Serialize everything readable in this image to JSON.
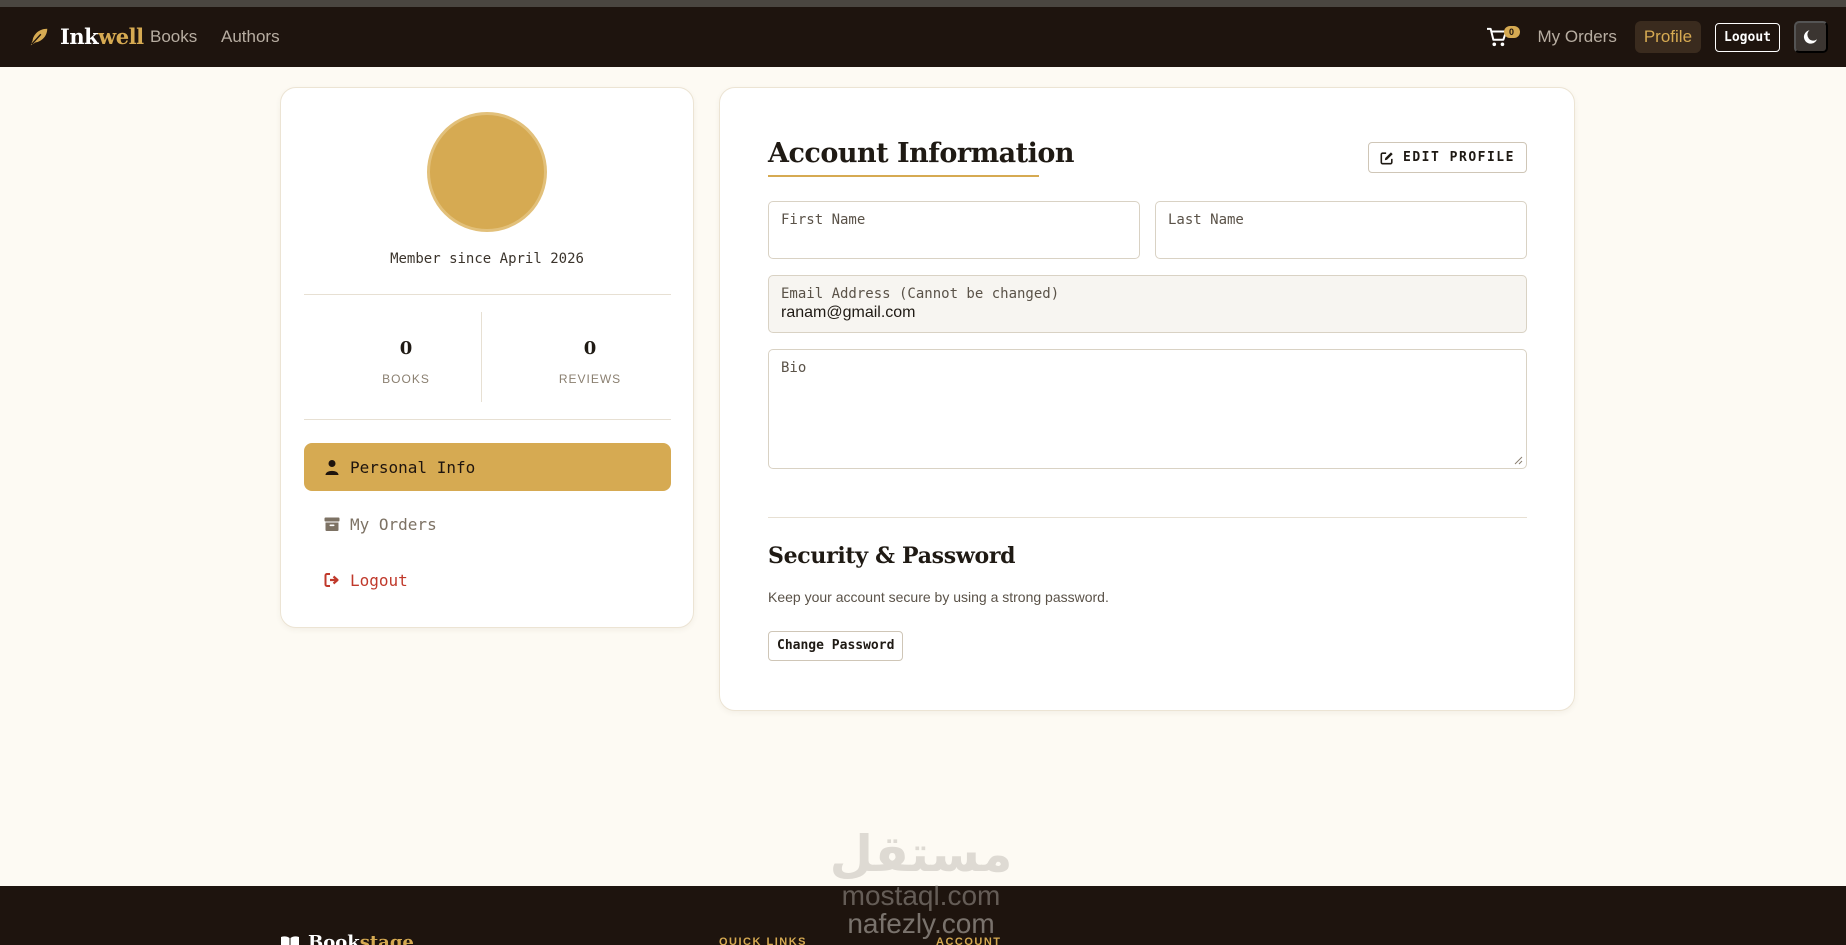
{
  "nav": {
    "brand_prefix": "Ink",
    "brand_accent": "well",
    "links": [
      "Books",
      "Authors"
    ],
    "cart_count": "0",
    "my_orders": "My Orders",
    "profile": "Profile",
    "logout": "Logout"
  },
  "sidebar": {
    "member_since": "Member since April 2026",
    "stats": [
      {
        "value": "0",
        "label": "BOOKS"
      },
      {
        "value": "0",
        "label": "REVIEWS"
      }
    ],
    "menu": [
      {
        "label": "Personal Info",
        "icon": "user-icon",
        "active": true
      },
      {
        "label": "My Orders",
        "icon": "archive-icon",
        "active": false
      },
      {
        "label": "Logout",
        "icon": "sign-out-icon",
        "active": false
      }
    ]
  },
  "account": {
    "title": "Account Information",
    "edit_button": "EDIT PROFILE",
    "fields": {
      "first_name": {
        "label": "First Name",
        "value": ""
      },
      "last_name": {
        "label": "Last Name",
        "value": ""
      },
      "email": {
        "label": "Email Address (Cannot be changed)",
        "value": "ranam@gmail.com"
      },
      "bio": {
        "label": "Bio",
        "value": ""
      }
    }
  },
  "security": {
    "title": "Security & Password",
    "description": "Keep your account secure by using a strong password.",
    "button": "Change Password"
  },
  "footer": {
    "brand_prefix": "Book",
    "brand_accent": "stage",
    "col1": "QUICK LINKS",
    "col2": "ACCOUNT"
  },
  "watermark": {
    "arabic": "مستقل",
    "line1": "mostaql.com",
    "line2": "nafezly.com"
  },
  "colors": {
    "accent": "#d6aa52",
    "nav_bg": "#1e140e",
    "page_bg": "#fdfaf3",
    "danger": "#c0392b"
  }
}
